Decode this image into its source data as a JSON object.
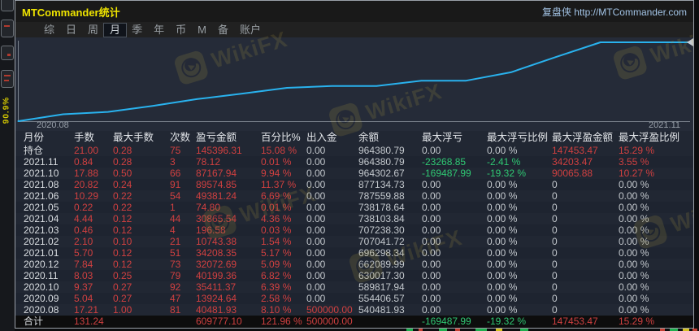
{
  "window": {
    "title": "MTCommander统计",
    "brand": "复盘侠 http://MTCommander.com"
  },
  "background_app": {
    "vertical_label": "90.9%"
  },
  "menu": {
    "items": [
      {
        "label": "综",
        "active": false
      },
      {
        "label": "日",
        "active": false
      },
      {
        "label": "周",
        "active": false
      },
      {
        "label": "月",
        "active": true
      },
      {
        "label": "季",
        "active": false
      },
      {
        "label": "年",
        "active": false
      },
      {
        "label": "币",
        "active": false
      },
      {
        "label": "M",
        "active": false
      },
      {
        "label": "备",
        "active": false
      },
      {
        "label": "账户",
        "active": false
      }
    ]
  },
  "watermark": {
    "text": "WikiFX"
  },
  "chart_data": {
    "type": "line",
    "title": "月度余额曲线",
    "x_axis_labels_visible": [
      "2020.08",
      "2021.11"
    ],
    "y_start": 500000,
    "line_color": "#29b2ee",
    "series": [
      {
        "name": "余额",
        "x": [
          "2020.08",
          "2020.09",
          "2020.10",
          "2020.11",
          "2020.12",
          "2021.01",
          "2021.02",
          "2021.03",
          "2021.04",
          "2021.05",
          "2021.06",
          "2021.08",
          "2021.10",
          "2021.11",
          "持仓"
        ],
        "values": [
          540481.93,
          554406.57,
          589817.94,
          630017.3,
          662089.99,
          696298.34,
          707041.72,
          707238.3,
          738103.84,
          738178.64,
          787559.88,
          877134.73,
          964302.67,
          964380.79,
          964380.79
        ]
      }
    ]
  },
  "table": {
    "columns": [
      "月份",
      "手数",
      "最大手数",
      "次数",
      "盈亏金额",
      "百分比%",
      "出入金",
      "余额",
      "最大浮亏",
      "最大浮亏比例",
      "最大浮盈金额",
      "最大浮盈比例"
    ],
    "rows": [
      {
        "cells": [
          [
            "持仓",
            "m"
          ],
          [
            "21.00",
            "r"
          ],
          [
            "0.28",
            "r"
          ],
          [
            "75",
            "r"
          ],
          [
            "145396.31",
            "r"
          ],
          [
            "15.08 %",
            "r"
          ],
          [
            "0.00",
            "w"
          ],
          [
            "964380.79",
            "w"
          ],
          [
            "0.00",
            "w"
          ],
          [
            "0.00 %",
            "w"
          ],
          [
            "147453.47",
            "r"
          ],
          [
            "15.29 %",
            "r"
          ]
        ]
      },
      {
        "cells": [
          [
            "2021.11",
            "m"
          ],
          [
            "0.84",
            "r"
          ],
          [
            "0.28",
            "r"
          ],
          [
            "3",
            "r"
          ],
          [
            "78.12",
            "r"
          ],
          [
            "0.01 %",
            "r"
          ],
          [
            "0.00",
            "w"
          ],
          [
            "964380.79",
            "w"
          ],
          [
            "-23268.85",
            "g"
          ],
          [
            "-2.41 %",
            "g"
          ],
          [
            "34203.47",
            "r"
          ],
          [
            "3.55 %",
            "r"
          ]
        ]
      },
      {
        "cells": [
          [
            "2021.10",
            "m"
          ],
          [
            "17.88",
            "r"
          ],
          [
            "0.50",
            "r"
          ],
          [
            "66",
            "r"
          ],
          [
            "87167.94",
            "r"
          ],
          [
            "9.94 %",
            "r"
          ],
          [
            "0.00",
            "w"
          ],
          [
            "964302.67",
            "w"
          ],
          [
            "-169487.99",
            "g"
          ],
          [
            "-19.32 %",
            "g"
          ],
          [
            "90065.88",
            "r"
          ],
          [
            "10.27 %",
            "r"
          ]
        ]
      },
      {
        "cells": [
          [
            "2021.08",
            "m"
          ],
          [
            "20.82",
            "r"
          ],
          [
            "0.24",
            "r"
          ],
          [
            "91",
            "r"
          ],
          [
            "89574.85",
            "r"
          ],
          [
            "11.37 %",
            "r"
          ],
          [
            "0.00",
            "w"
          ],
          [
            "877134.73",
            "w"
          ],
          [
            "0.00",
            "w"
          ],
          [
            "0.00 %",
            "w"
          ],
          [
            "0",
            "w"
          ],
          [
            "0.00 %",
            "w"
          ]
        ]
      },
      {
        "cells": [
          [
            "2021.06",
            "m"
          ],
          [
            "10.29",
            "r"
          ],
          [
            "0.22",
            "r"
          ],
          [
            "54",
            "r"
          ],
          [
            "49381.24",
            "r"
          ],
          [
            "6.69 %",
            "r"
          ],
          [
            "0.00",
            "w"
          ],
          [
            "787559.88",
            "w"
          ],
          [
            "0.00",
            "w"
          ],
          [
            "0.00 %",
            "w"
          ],
          [
            "0",
            "w"
          ],
          [
            "0.00 %",
            "w"
          ]
        ]
      },
      {
        "cells": [
          [
            "2021.05",
            "m"
          ],
          [
            "0.22",
            "r"
          ],
          [
            "0.22",
            "r"
          ],
          [
            "1",
            "r"
          ],
          [
            "74.80",
            "r"
          ],
          [
            "0.01 %",
            "r"
          ],
          [
            "0.00",
            "w"
          ],
          [
            "738178.64",
            "w"
          ],
          [
            "0.00",
            "w"
          ],
          [
            "0.00 %",
            "w"
          ],
          [
            "0",
            "w"
          ],
          [
            "0.00 %",
            "w"
          ]
        ]
      },
      {
        "cells": [
          [
            "2021.04",
            "m"
          ],
          [
            "4.44",
            "r"
          ],
          [
            "0.12",
            "r"
          ],
          [
            "44",
            "r"
          ],
          [
            "30865.54",
            "r"
          ],
          [
            "4.36 %",
            "r"
          ],
          [
            "0.00",
            "w"
          ],
          [
            "738103.84",
            "w"
          ],
          [
            "0.00",
            "w"
          ],
          [
            "0.00 %",
            "w"
          ],
          [
            "0",
            "w"
          ],
          [
            "0.00 %",
            "w"
          ]
        ]
      },
      {
        "cells": [
          [
            "2021.03",
            "m"
          ],
          [
            "0.46",
            "r"
          ],
          [
            "0.12",
            "r"
          ],
          [
            "4",
            "r"
          ],
          [
            "196.58",
            "r"
          ],
          [
            "0.03 %",
            "r"
          ],
          [
            "0.00",
            "w"
          ],
          [
            "707238.30",
            "w"
          ],
          [
            "0.00",
            "w"
          ],
          [
            "0.00 %",
            "w"
          ],
          [
            "0",
            "w"
          ],
          [
            "0.00 %",
            "w"
          ]
        ]
      },
      {
        "cells": [
          [
            "2021.02",
            "m"
          ],
          [
            "2.10",
            "r"
          ],
          [
            "0.10",
            "r"
          ],
          [
            "21",
            "r"
          ],
          [
            "10743.38",
            "r"
          ],
          [
            "1.54 %",
            "r"
          ],
          [
            "0.00",
            "w"
          ],
          [
            "707041.72",
            "w"
          ],
          [
            "0.00",
            "w"
          ],
          [
            "0.00 %",
            "w"
          ],
          [
            "0",
            "w"
          ],
          [
            "0.00 %",
            "w"
          ]
        ]
      },
      {
        "cells": [
          [
            "2021.01",
            "m"
          ],
          [
            "5.70",
            "r"
          ],
          [
            "0.12",
            "r"
          ],
          [
            "51",
            "r"
          ],
          [
            "34208.35",
            "r"
          ],
          [
            "5.17 %",
            "r"
          ],
          [
            "0.00",
            "w"
          ],
          [
            "696298.34",
            "w"
          ],
          [
            "0.00",
            "w"
          ],
          [
            "0.00 %",
            "w"
          ],
          [
            "0",
            "w"
          ],
          [
            "0.00 %",
            "w"
          ]
        ]
      },
      {
        "cells": [
          [
            "2020.12",
            "m"
          ],
          [
            "7.84",
            "r"
          ],
          [
            "0.12",
            "r"
          ],
          [
            "73",
            "r"
          ],
          [
            "32072.69",
            "r"
          ],
          [
            "5.09 %",
            "r"
          ],
          [
            "0.00",
            "w"
          ],
          [
            "662089.99",
            "w"
          ],
          [
            "0.00",
            "w"
          ],
          [
            "0.00 %",
            "w"
          ],
          [
            "0",
            "w"
          ],
          [
            "0.00 %",
            "w"
          ]
        ]
      },
      {
        "cells": [
          [
            "2020.11",
            "m"
          ],
          [
            "8.03",
            "r"
          ],
          [
            "0.25",
            "r"
          ],
          [
            "79",
            "r"
          ],
          [
            "40199.36",
            "r"
          ],
          [
            "6.82 %",
            "r"
          ],
          [
            "0.00",
            "w"
          ],
          [
            "630017.30",
            "w"
          ],
          [
            "0.00",
            "w"
          ],
          [
            "0.00 %",
            "w"
          ],
          [
            "0",
            "w"
          ],
          [
            "0.00 %",
            "w"
          ]
        ]
      },
      {
        "cells": [
          [
            "2020.10",
            "m"
          ],
          [
            "9.37",
            "r"
          ],
          [
            "0.27",
            "r"
          ],
          [
            "92",
            "r"
          ],
          [
            "35411.37",
            "r"
          ],
          [
            "6.39 %",
            "r"
          ],
          [
            "0.00",
            "w"
          ],
          [
            "589817.94",
            "w"
          ],
          [
            "0.00",
            "w"
          ],
          [
            "0.00 %",
            "w"
          ],
          [
            "0",
            "w"
          ],
          [
            "0.00 %",
            "w"
          ]
        ]
      },
      {
        "cells": [
          [
            "2020.09",
            "m"
          ],
          [
            "5.04",
            "r"
          ],
          [
            "0.27",
            "r"
          ],
          [
            "47",
            "r"
          ],
          [
            "13924.64",
            "r"
          ],
          [
            "2.58 %",
            "r"
          ],
          [
            "0.00",
            "w"
          ],
          [
            "554406.57",
            "w"
          ],
          [
            "0.00",
            "w"
          ],
          [
            "0.00 %",
            "w"
          ],
          [
            "0",
            "w"
          ],
          [
            "0.00 %",
            "w"
          ]
        ]
      },
      {
        "cells": [
          [
            "2020.08",
            "m"
          ],
          [
            "17.21",
            "r"
          ],
          [
            "1.00",
            "r"
          ],
          [
            "81",
            "r"
          ],
          [
            "40481.93",
            "r"
          ],
          [
            "8.10 %",
            "r"
          ],
          [
            "500000.00",
            "r"
          ],
          [
            "540481.93",
            "w"
          ],
          [
            "0.00",
            "w"
          ],
          [
            "0.00 %",
            "w"
          ],
          [
            "0",
            "w"
          ],
          [
            "0.00 %",
            "w"
          ]
        ]
      },
      {
        "total": true,
        "cells": [
          [
            "合计",
            "m"
          ],
          [
            "131.24",
            "r"
          ],
          [
            "",
            "w"
          ],
          [
            "",
            "w"
          ],
          [
            "609777.10",
            "r"
          ],
          [
            "121.96 %",
            "r"
          ],
          [
            "500000.00",
            "r"
          ],
          [
            "",
            "w"
          ],
          [
            "-169487.99",
            "g"
          ],
          [
            "-19.32 %",
            "g"
          ],
          [
            "147453.47",
            "r"
          ],
          [
            "15.29 %",
            "r"
          ]
        ]
      }
    ]
  }
}
